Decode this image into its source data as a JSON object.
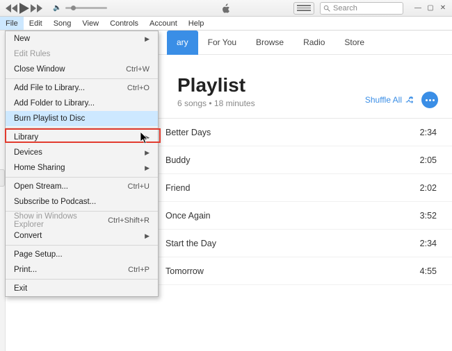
{
  "menubar": [
    "File",
    "Edit",
    "Song",
    "View",
    "Controls",
    "Account",
    "Help"
  ],
  "search_placeholder": "Search",
  "navtabs": {
    "active_fragment": "ary",
    "items": [
      "For You",
      "Browse",
      "Radio",
      "Store"
    ]
  },
  "playlist": {
    "title": "Playlist",
    "subtitle": "6 songs • 18 minutes",
    "shuffle_label": "Shuffle All"
  },
  "songs": [
    {
      "title": "Better Days",
      "duration": "2:34"
    },
    {
      "title": "Buddy",
      "duration": "2:05"
    },
    {
      "title": "Friend",
      "duration": "2:02"
    },
    {
      "title": "Once Again",
      "duration": "3:52"
    },
    {
      "title": "Start the Day",
      "duration": "2:34"
    },
    {
      "title": "Tomorrow",
      "duration": "4:55"
    }
  ],
  "file_menu": [
    {
      "label": "New",
      "submenu": true
    },
    {
      "label": "Edit Rules",
      "disabled": true
    },
    {
      "label": "Close Window",
      "shortcut": "Ctrl+W"
    },
    {
      "sep": true
    },
    {
      "label": "Add File to Library...",
      "shortcut": "Ctrl+O"
    },
    {
      "label": "Add Folder to Library..."
    },
    {
      "label": "Burn Playlist to Disc",
      "hovered": true
    },
    {
      "sep": true
    },
    {
      "label": "Library",
      "submenu": true
    },
    {
      "label": "Devices",
      "submenu": true
    },
    {
      "label": "Home Sharing",
      "submenu": true
    },
    {
      "sep": true
    },
    {
      "label": "Open Stream...",
      "shortcut": "Ctrl+U"
    },
    {
      "label": "Subscribe to Podcast..."
    },
    {
      "sep": true
    },
    {
      "label": "Show in Windows Explorer",
      "shortcut": "Ctrl+Shift+R",
      "disabled": true
    },
    {
      "label": "Convert",
      "submenu": true
    },
    {
      "sep": true
    },
    {
      "label": "Page Setup..."
    },
    {
      "label": "Print...",
      "shortcut": "Ctrl+P"
    },
    {
      "sep": true
    },
    {
      "label": "Exit"
    }
  ]
}
